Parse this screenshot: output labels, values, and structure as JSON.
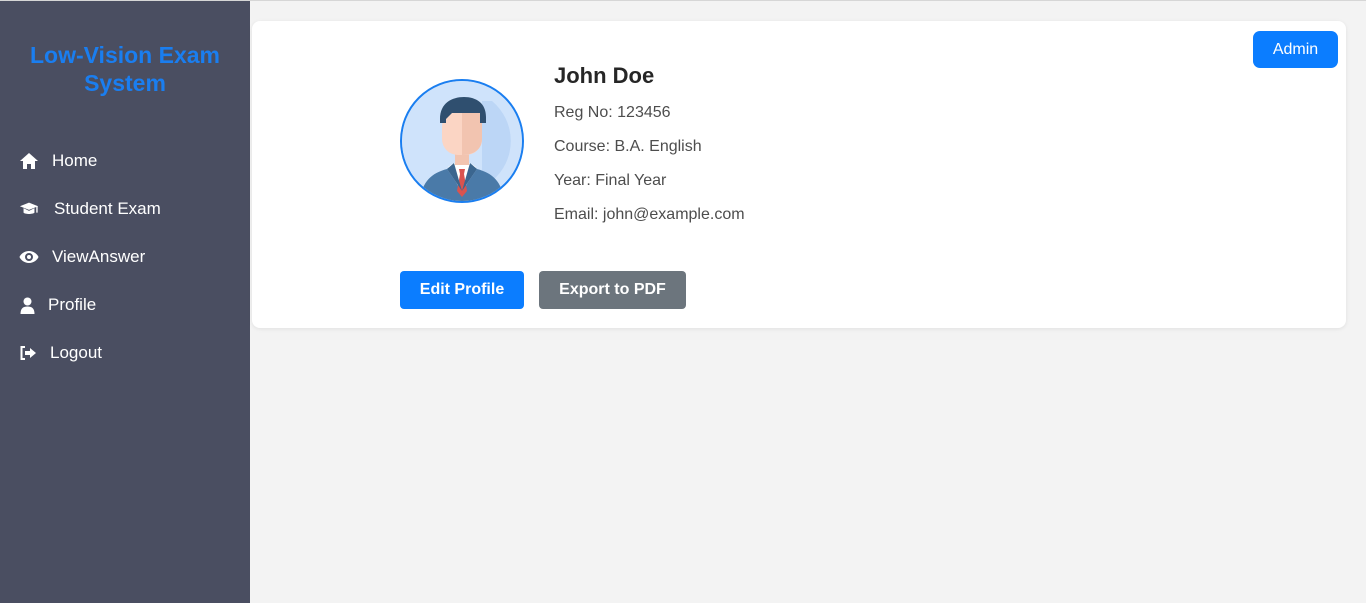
{
  "sidebar": {
    "brand": "Low-Vision Exam System",
    "items": [
      {
        "label": "Home",
        "icon": "home-icon"
      },
      {
        "label": "Student Exam",
        "icon": "graduation-cap-icon"
      },
      {
        "label": "ViewAnswer",
        "icon": "eye-icon"
      },
      {
        "label": "Profile",
        "icon": "user-icon"
      },
      {
        "label": "Logout",
        "icon": "sign-out-icon"
      }
    ]
  },
  "header": {
    "admin_label": "Admin"
  },
  "profile": {
    "name": "John Doe",
    "reg_no": "Reg No: 123456",
    "course": "Course: B.A. English",
    "year": "Year: Final Year",
    "email": "Email: john@example.com",
    "avatar_icon": "businessman-avatar-icon"
  },
  "actions": {
    "edit_label": "Edit Profile",
    "export_label": "Export to PDF"
  },
  "colors": {
    "accent": "#0b7dff",
    "sidebar_bg": "#4a4e61",
    "secondary_button": "#6c757d"
  }
}
